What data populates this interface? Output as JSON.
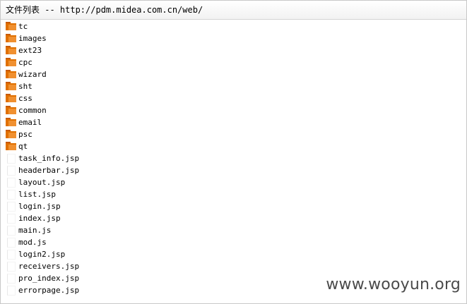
{
  "header": {
    "title": "文件列表 -- http://pdm.midea.com.cn/web/"
  },
  "folders": [
    {
      "name": "tc",
      "icon": "folder-icon"
    },
    {
      "name": "images",
      "icon": "folder-icon"
    },
    {
      "name": "ext23",
      "icon": "folder-icon"
    },
    {
      "name": "cpc",
      "icon": "folder-icon"
    },
    {
      "name": "wizard",
      "icon": "folder-icon"
    },
    {
      "name": "sht",
      "icon": "folder-icon"
    },
    {
      "name": "css",
      "icon": "folder-icon"
    },
    {
      "name": "common",
      "icon": "folder-icon"
    },
    {
      "name": "email",
      "icon": "folder-icon"
    },
    {
      "name": "psc",
      "icon": "folder-icon"
    },
    {
      "name": "qt",
      "icon": "folder-icon"
    }
  ],
  "files": [
    {
      "name": "task_info.jsp",
      "icon": "file-icon"
    },
    {
      "name": "headerbar.jsp",
      "icon": "file-icon"
    },
    {
      "name": "layout.jsp",
      "icon": "file-icon"
    },
    {
      "name": "list.jsp",
      "icon": "file-icon"
    },
    {
      "name": "login.jsp",
      "icon": "file-icon"
    },
    {
      "name": "index.jsp",
      "icon": "file-icon"
    },
    {
      "name": "main.js",
      "icon": "file-icon"
    },
    {
      "name": "mod.js",
      "icon": "file-icon"
    },
    {
      "name": "login2.jsp",
      "icon": "file-icon"
    },
    {
      "name": "receivers.jsp",
      "icon": "file-icon"
    },
    {
      "name": "pro_index.jsp",
      "icon": "file-icon"
    },
    {
      "name": "errorpage.jsp",
      "icon": "file-icon"
    }
  ],
  "watermark": {
    "text": "www.wooyun.org"
  },
  "colors": {
    "folder": "#e07000",
    "folder_dark": "#c85a00",
    "text": "#000000",
    "watermark": "#4a4a4a"
  }
}
